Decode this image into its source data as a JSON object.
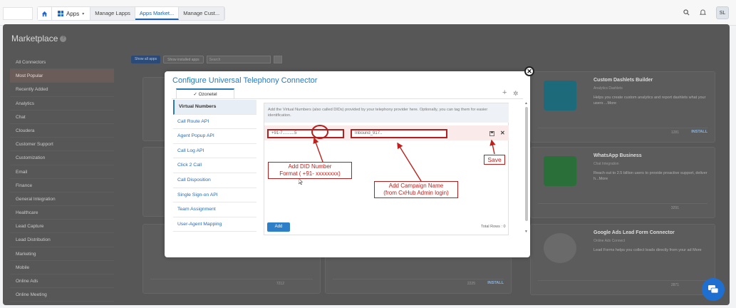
{
  "topbar": {
    "logo_text": "",
    "apps_label": "Apps",
    "tabs": [
      "Manage Lapps",
      "Apps Market...",
      "Manage Cust..."
    ],
    "active_tab": 1,
    "avatar": "SL"
  },
  "page": {
    "title": "Marketplace",
    "categories": [
      "All Connectors",
      "Most Popular",
      "Recently Added",
      "Analytics",
      "Chat",
      "Cloudera",
      "Customer Support",
      "Customization",
      "Email",
      "Finance",
      "General Integration",
      "Healthcare",
      "Lead Capture",
      "Lead Distribution",
      "Marketing",
      "Mobile",
      "Online Ads",
      "Online Meeting"
    ],
    "selected_category": 1,
    "filters": {
      "primary": "Show all apps",
      "secondary": "Show installed apps",
      "search_placeholder": "Search"
    },
    "cards": [
      {
        "title": "Custom Dashlets Builder",
        "subtitle": "Analytics Dashlets",
        "desc": "Helps you create custom analytics and report dashlets what your users ...More",
        "count": "1281",
        "action": "INSTALL"
      },
      {
        "title": "WhatsApp Business",
        "subtitle": "Chat Integration",
        "desc": "Reach out to 2.5 billion users to provide proactive support, deliver h...More",
        "count": "3291",
        "action": ""
      },
      {
        "title": "Google Ads Lead Form Connector",
        "subtitle": "Online Ads Connect",
        "desc": "Lead Forms helps you collect leads directly from your ad More",
        "count": "2871",
        "action": ""
      }
    ],
    "bottom_counts": [
      "7212",
      "2225"
    ],
    "bottom_action": "INSTALL"
  },
  "modal": {
    "title": "Configure Universal Telephony Connector",
    "provider_tab": "Ozonetel",
    "menu": [
      "Virtual Numbers",
      "Call Route API",
      "Agent Popup API",
      "Call Log API",
      "Click 2 Call",
      "Call Disposition",
      "Single Sign-on API",
      "Team Assignment",
      "User-Agent Mapping"
    ],
    "active_menu": 0,
    "info_text": "Add the Virtual Numbers (also called DIDs) provided by your telephony provider here. Optionally, you can tag them for easier identification.",
    "did_value": "+91-7..........5",
    "campaign_value": "Inbound_917..",
    "add_label": "Add",
    "total_rows": "Total Rows : 0"
  },
  "annotations": {
    "did": "Add DID Number Format ( +91- xxxxxxxx)",
    "did_line1": "Add DID Number",
    "did_line2": "Format ( +91- xxxxxxxx)",
    "campaign_line1": "Add Campaign Name",
    "campaign_line2": "(from CxHub Admin login)",
    "save": "Save",
    "color": "#b22020"
  },
  "icons": [
    "home-icon",
    "apps-grid-icon",
    "search-icon",
    "bell-icon",
    "close-icon",
    "plus-icon",
    "gear-icon",
    "save-icon",
    "delete-icon",
    "chat-icon"
  ]
}
